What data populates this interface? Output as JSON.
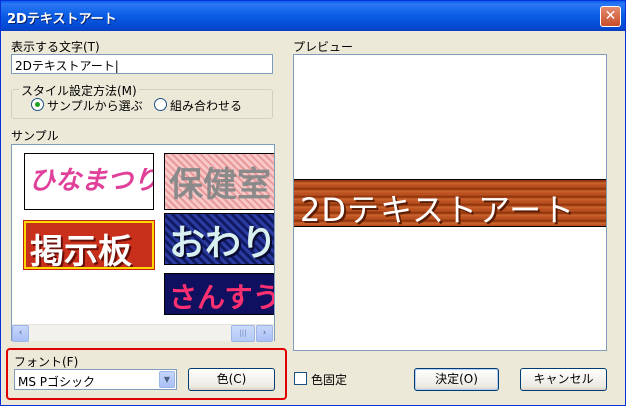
{
  "window": {
    "title": "2Dテキストアート",
    "close_glyph": "✕"
  },
  "text_input": {
    "label": "表示する文字(T)",
    "value": "2Dテキストアート|"
  },
  "style_method": {
    "legend": "スタイル設定方法(M)",
    "options": [
      "サンプルから選ぶ",
      "組み合わせる"
    ],
    "selected_index": 0
  },
  "samples": {
    "label": "サンプル",
    "tiles": [
      {
        "text": "ひなまつり",
        "bg": "#ffffff",
        "fg": "#e0409a",
        "selected": false
      },
      {
        "text": "保健室",
        "bg": "#f4b8b8",
        "fg": "#9a9a9a",
        "selected": false
      },
      {
        "text": "掲示板",
        "bg": "#c8301c",
        "fg": "#ffffff",
        "selected": true
      },
      {
        "text": "おわり",
        "bg": "#1c2a8a",
        "fg": "#d8f0f0",
        "selected": false
      },
      {
        "text": "さんすう",
        "bg": "#101060",
        "fg": "#ff3070",
        "selected": false
      }
    ]
  },
  "scrollbar": {
    "left_glyph": "‹",
    "right_glyph": "›",
    "thumb_glyph": "|||"
  },
  "preview": {
    "label": "プレビュー",
    "text": "2Dテキストアート"
  },
  "font": {
    "label": "フォント(F)",
    "value": "MS Pゴシック",
    "arrow": "▼"
  },
  "color_button": {
    "label": "色(C)"
  },
  "color_fixed": {
    "label": "色固定"
  },
  "ok_button": {
    "label": "決定(O)"
  },
  "cancel_button": {
    "label": "キャンセル"
  },
  "colors": {
    "highlight": "#e00000",
    "titlebar": "#0a5ef0"
  }
}
